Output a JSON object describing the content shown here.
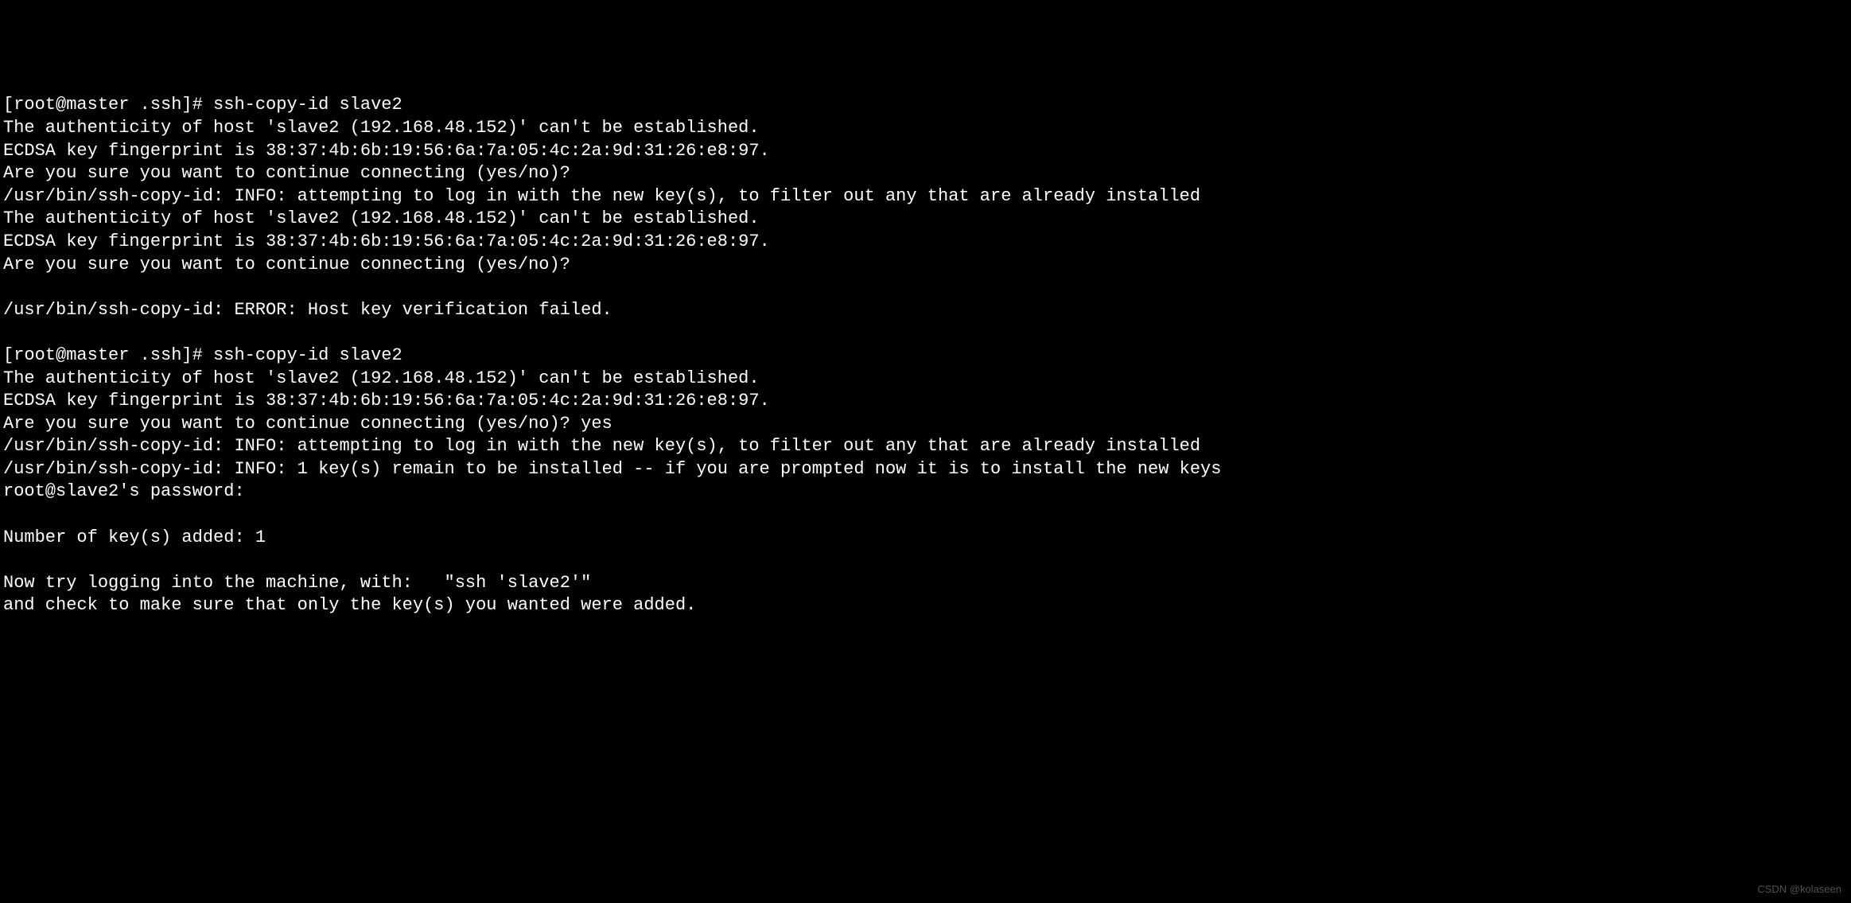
{
  "terminal": {
    "lines": [
      "[root@master .ssh]# ssh-copy-id slave2",
      "The authenticity of host 'slave2 (192.168.48.152)' can't be established.",
      "ECDSA key fingerprint is 38:37:4b:6b:19:56:6a:7a:05:4c:2a:9d:31:26:e8:97.",
      "Are you sure you want to continue connecting (yes/no)?",
      "/usr/bin/ssh-copy-id: INFO: attempting to log in with the new key(s), to filter out any that are already installed",
      "The authenticity of host 'slave2 (192.168.48.152)' can't be established.",
      "ECDSA key fingerprint is 38:37:4b:6b:19:56:6a:7a:05:4c:2a:9d:31:26:e8:97.",
      "Are you sure you want to continue connecting (yes/no)?",
      "",
      "/usr/bin/ssh-copy-id: ERROR: Host key verification failed.",
      "",
      "[root@master .ssh]# ssh-copy-id slave2",
      "The authenticity of host 'slave2 (192.168.48.152)' can't be established.",
      "ECDSA key fingerprint is 38:37:4b:6b:19:56:6a:7a:05:4c:2a:9d:31:26:e8:97.",
      "Are you sure you want to continue connecting (yes/no)? yes",
      "/usr/bin/ssh-copy-id: INFO: attempting to log in with the new key(s), to filter out any that are already installed",
      "/usr/bin/ssh-copy-id: INFO: 1 key(s) remain to be installed -- if you are prompted now it is to install the new keys",
      "root@slave2's password:",
      "",
      "Number of key(s) added: 1",
      "",
      "Now try logging into the machine, with:   \"ssh 'slave2'\"",
      "and check to make sure that only the key(s) you wanted were added."
    ]
  },
  "watermark": "CSDN @kolaseen"
}
